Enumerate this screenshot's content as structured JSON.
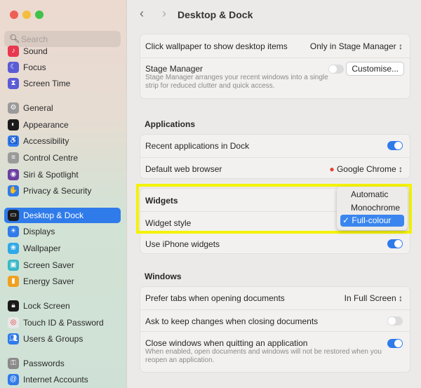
{
  "window": {
    "controls": [
      "close",
      "minimize",
      "zoom"
    ]
  },
  "sidebar": {
    "search_placeholder": "Search",
    "items": [
      {
        "label": "Sound",
        "icon": "speaker-icon",
        "color": "#e8384f"
      },
      {
        "label": "Focus",
        "icon": "moon-icon",
        "color": "#5b5bd6"
      },
      {
        "label": "Screen Time",
        "icon": "hourglass-icon",
        "color": "#5b5bd6"
      },
      {
        "label": "General",
        "icon": "gear-icon",
        "color": "#9a9a9a"
      },
      {
        "label": "Appearance",
        "icon": "appearance-icon",
        "color": "#1a1a1a"
      },
      {
        "label": "Accessibility",
        "icon": "accessibility-icon",
        "color": "#2f7bea"
      },
      {
        "label": "Control Centre",
        "icon": "control-centre-icon",
        "color": "#9a9a9a"
      },
      {
        "label": "Siri & Spotlight",
        "icon": "siri-icon",
        "color": "#6b3fa0"
      },
      {
        "label": "Privacy & Security",
        "icon": "hand-icon",
        "color": "#2f7bea"
      },
      {
        "label": "Desktop & Dock",
        "icon": "dock-icon",
        "color": "#1a1a1a",
        "selected": true
      },
      {
        "label": "Displays",
        "icon": "display-icon",
        "color": "#2f7bea"
      },
      {
        "label": "Wallpaper",
        "icon": "wallpaper-icon",
        "color": "#2fa8e8"
      },
      {
        "label": "Screen Saver",
        "icon": "screen-saver-icon",
        "color": "#3ab8c8"
      },
      {
        "label": "Energy Saver",
        "icon": "battery-icon",
        "color": "#f0a020"
      },
      {
        "label": "Lock Screen",
        "icon": "lock-icon",
        "color": "#1a1a1a"
      },
      {
        "label": "Touch ID & Password",
        "icon": "fingerprint-icon",
        "color": "#e8e8e8"
      },
      {
        "label": "Users & Groups",
        "icon": "users-icon",
        "color": "#2f7bea"
      },
      {
        "label": "Passwords",
        "icon": "key-icon",
        "color": "#8a8a8a"
      },
      {
        "label": "Internet Accounts",
        "icon": "at-icon",
        "color": "#2f7bea"
      }
    ]
  },
  "header": {
    "title": "Desktop & Dock"
  },
  "desktop": {
    "click_wallpaper_label": "Click wallpaper to show desktop items",
    "click_wallpaper_value": "Only in Stage Manager",
    "stage_manager_label": "Stage Manager",
    "stage_manager_desc": "Stage Manager arranges your recent windows into a single strip for reduced clutter and quick access.",
    "stage_manager_on": false,
    "customise_label": "Customise..."
  },
  "applications": {
    "heading": "Applications",
    "recent_label": "Recent applications in Dock",
    "recent_on": true,
    "browser_label": "Default web browser",
    "browser_value": "Google Chrome"
  },
  "widgets": {
    "heading": "Widgets",
    "style_label": "Widget style",
    "style_options": [
      "Automatic",
      "Monochrome",
      "Full-colour"
    ],
    "style_selected": "Full-colour",
    "iphone_label": "Use iPhone widgets",
    "iphone_on": true
  },
  "windows": {
    "heading": "Windows",
    "prefer_tabs_label": "Prefer tabs when opening documents",
    "prefer_tabs_value": "In Full Screen",
    "ask_keep_label": "Ask to keep changes when closing documents",
    "ask_keep_on": false,
    "close_windows_label": "Close windows when quitting an application",
    "close_windows_desc": "When enabled, open documents and windows will not be restored when you reopen an application.",
    "close_windows_on": true
  },
  "highlight_color": "#f5f200",
  "accent": "#2f7bea"
}
